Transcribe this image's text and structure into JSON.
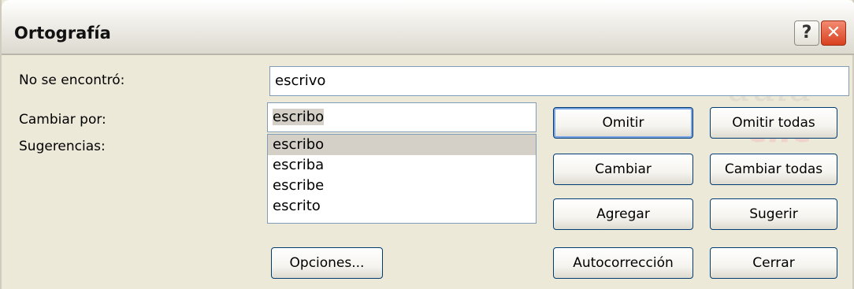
{
  "window": {
    "title": "Ortografía",
    "help_glyph": "?",
    "close_glyph": "✕"
  },
  "watermark": {
    "line1": "aula",
    "line2": "clic"
  },
  "form": {
    "not_found_label": "No se encontró:",
    "not_found_value": "escrivo",
    "change_to_label": "Cambiar por:",
    "change_to_value": "escribo",
    "suggestions_label": "Sugerencias:",
    "suggestions": [
      "escribo",
      "escriba",
      "escribe",
      "escrito"
    ],
    "selected_suggestion": "escribo"
  },
  "buttons": {
    "omitir": "Omitir",
    "omitir_todas": "Omitir todas",
    "cambiar": "Cambiar",
    "cambiar_todas": "Cambiar todas",
    "agregar": "Agregar",
    "sugerir": "Sugerir",
    "opciones": "Opciones...",
    "autocorreccion": "Autocorrección",
    "cerrar": "Cerrar"
  }
}
